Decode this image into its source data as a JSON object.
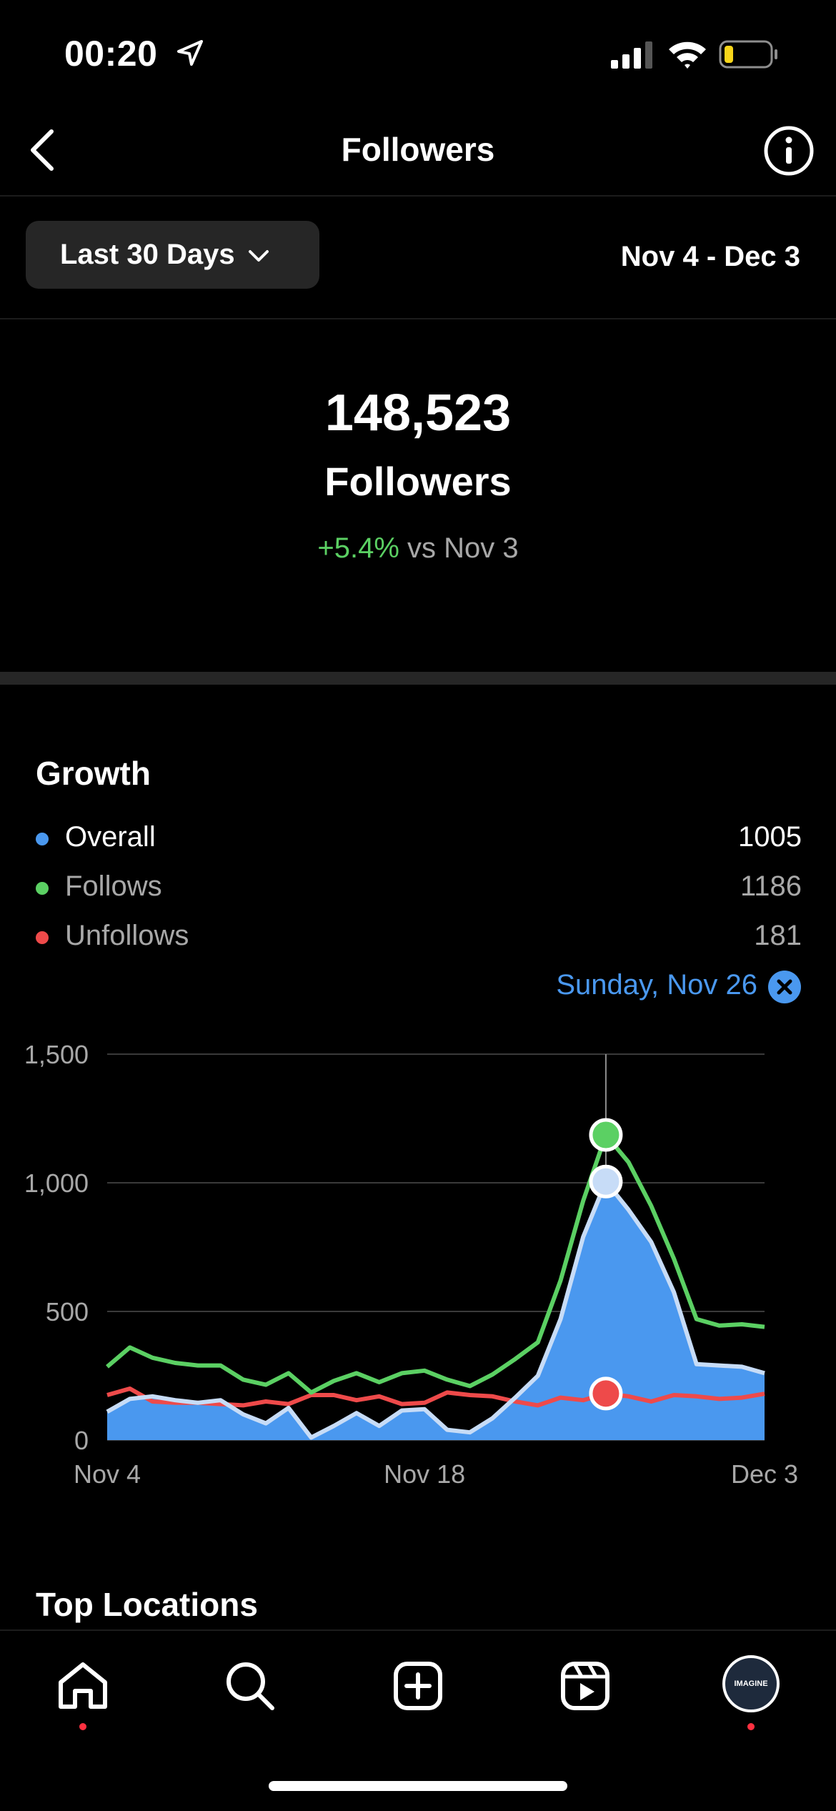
{
  "status_bar": {
    "time": "00:20"
  },
  "nav": {
    "title": "Followers"
  },
  "filter": {
    "range_label": "Last 30 Days",
    "date_range": "Nov 4 - Dec 3"
  },
  "summary": {
    "count": "148,523",
    "label": "Followers",
    "change_pct": "+5.4%",
    "change_vs": "vs Nov 3"
  },
  "growth": {
    "title": "Growth",
    "legend": [
      {
        "label": "Overall",
        "value": "1005",
        "color": "#4a98ef"
      },
      {
        "label": "Follows",
        "value": "1186",
        "color": "#5bd063"
      },
      {
        "label": "Unfollows",
        "value": "181",
        "color": "#ee4a4a"
      }
    ],
    "selected_date": "Sunday, Nov 26"
  },
  "chart_data": {
    "type": "area",
    "x": [
      "Nov 4",
      "Nov 5",
      "Nov 6",
      "Nov 7",
      "Nov 8",
      "Nov 9",
      "Nov 10",
      "Nov 11",
      "Nov 12",
      "Nov 13",
      "Nov 14",
      "Nov 15",
      "Nov 16",
      "Nov 17",
      "Nov 18",
      "Nov 19",
      "Nov 20",
      "Nov 21",
      "Nov 22",
      "Nov 23",
      "Nov 24",
      "Nov 25",
      "Nov 26",
      "Nov 27",
      "Nov 28",
      "Nov 29",
      "Nov 30",
      "Dec 1",
      "Dec 2",
      "Dec 3"
    ],
    "series": [
      {
        "name": "Overall",
        "values": [
          110,
          160,
          170,
          155,
          145,
          155,
          100,
          65,
          125,
          10,
          55,
          105,
          55,
          115,
          120,
          40,
          30,
          85,
          165,
          250,
          470,
          790,
          1005,
          895,
          770,
          575,
          295,
          290,
          285,
          260
        ]
      },
      {
        "name": "Follows",
        "values": [
          285,
          360,
          320,
          300,
          290,
          290,
          235,
          215,
          260,
          185,
          230,
          260,
          225,
          260,
          270,
          235,
          210,
          255,
          315,
          380,
          620,
          930,
          1186,
          1080,
          910,
          705,
          470,
          445,
          450,
          440
        ]
      },
      {
        "name": "Unfollows",
        "values": [
          175,
          200,
          150,
          145,
          145,
          140,
          135,
          150,
          140,
          175,
          175,
          155,
          170,
          140,
          145,
          185,
          175,
          170,
          150,
          135,
          165,
          155,
          181,
          170,
          150,
          175,
          170,
          160,
          165,
          180
        ]
      }
    ],
    "x_ticks": [
      "Nov 4",
      "Nov 18",
      "Dec 3"
    ],
    "y_ticks": [
      "0",
      "500",
      "1,000",
      "1,500"
    ],
    "ylim": [
      0,
      1500
    ],
    "highlight_index": 22,
    "grid": true
  },
  "top_locations": {
    "title": "Top Locations"
  },
  "tab_bar": {
    "items": [
      {
        "name": "home",
        "icon": "home-icon"
      },
      {
        "name": "search",
        "icon": "search-icon"
      },
      {
        "name": "create",
        "icon": "plus-square-icon"
      },
      {
        "name": "reels",
        "icon": "reels-icon"
      },
      {
        "name": "profile",
        "icon": "avatar"
      }
    ],
    "avatar_text": "IMAGINE"
  }
}
